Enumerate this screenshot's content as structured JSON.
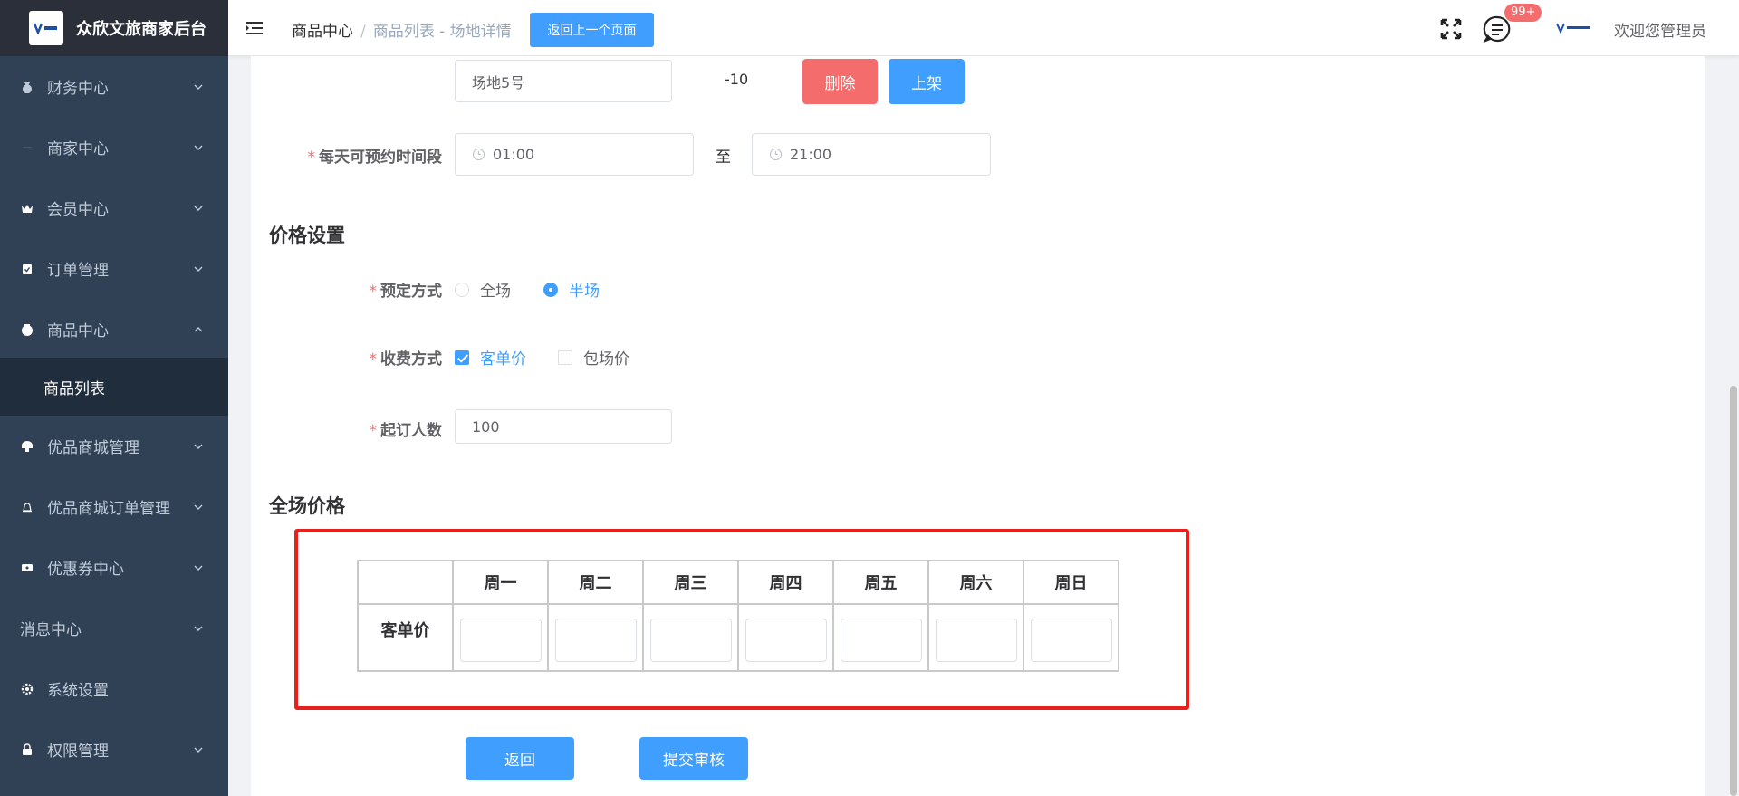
{
  "sidebar": {
    "logo_title": "众欣文旅商家后台",
    "items": [
      {
        "label": "财务中心",
        "icon": "money-bag-icon"
      },
      {
        "label": "商家中心",
        "icon": "shop-icon"
      },
      {
        "label": "会员中心",
        "icon": "crown-icon"
      },
      {
        "label": "订单管理",
        "icon": "clipboard-icon"
      },
      {
        "label": "商品中心",
        "icon": "goods-icon"
      },
      {
        "label": "优品商城管理",
        "icon": "store-icon"
      },
      {
        "label": "优品商城订单管理",
        "icon": "bell-icon"
      },
      {
        "label": "优惠券中心",
        "icon": "ticket-icon"
      },
      {
        "label": "消息中心",
        "icon": ""
      },
      {
        "label": "系统设置",
        "icon": "gear-icon"
      },
      {
        "label": "权限管理",
        "icon": "lock-icon"
      }
    ],
    "active_sub": "商品列表"
  },
  "header": {
    "breadcrumb": [
      "商品中心",
      "商品列表 - 场地详情"
    ],
    "back_prev": "返回上一个页面",
    "badge": "99+",
    "welcome": "欢迎您管理员"
  },
  "form": {
    "venue_name": "场地5号",
    "venue_offset": "-10",
    "delete_btn": "删除",
    "shelf_btn": "上架",
    "time_label": "每天可预约时间段",
    "time_start": "01:00",
    "time_to": "至",
    "time_end": "21:00",
    "price_section": "价格设置",
    "booking_label": "预定方式",
    "booking_opts": [
      "全场",
      "半场"
    ],
    "booking_selected": "半场",
    "charge_label": "收费方式",
    "charge_opts": [
      "客单价",
      "包场价"
    ],
    "charge_checked": [
      "客单价"
    ],
    "min_people_label": "起订人数",
    "min_people": "100",
    "full_price_section": "全场价格"
  },
  "price_table": {
    "days": [
      "周一",
      "周二",
      "周三",
      "周四",
      "周五",
      "周六",
      "周日"
    ],
    "row_label": "客单价",
    "values": [
      "",
      "",
      "",
      "",
      "",
      "",
      ""
    ]
  },
  "actions": {
    "back": "返回",
    "submit": "提交审核"
  },
  "colors": {
    "primary": "#409eff",
    "danger": "#f56c6c",
    "sidebar_bg": "#304156",
    "highlight": "#e8201c"
  }
}
